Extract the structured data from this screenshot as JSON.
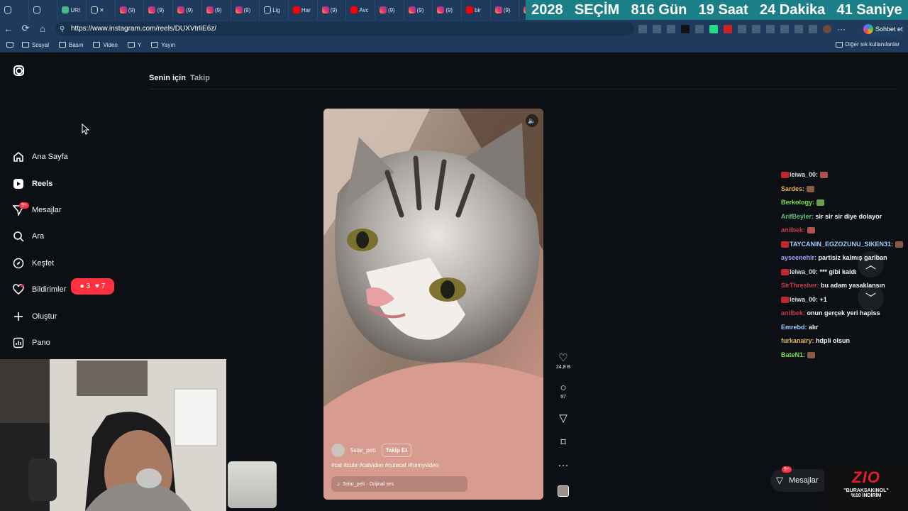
{
  "browser": {
    "tabs": [
      {
        "icon": "chevron-down-icon",
        "label": ""
      },
      {
        "icon": "tab-groups-icon",
        "label": ""
      },
      {
        "icon": "uri-icon",
        "label": "URI"
      },
      {
        "icon": "audio-icon",
        "label": "✕"
      },
      {
        "icon": "instagram-icon",
        "label": "(9)"
      },
      {
        "icon": "instagram-icon",
        "label": "(9)"
      },
      {
        "icon": "instagram-icon",
        "label": "(9)"
      },
      {
        "icon": "instagram-icon",
        "label": "(9)"
      },
      {
        "icon": "instagram-icon",
        "label": "(9)"
      },
      {
        "icon": "pen-icon",
        "label": "Lig"
      },
      {
        "icon": "youtube-icon",
        "label": "Har"
      },
      {
        "icon": "instagram-icon",
        "label": "(9)"
      },
      {
        "icon": "youtube-icon",
        "label": "Avc"
      },
      {
        "icon": "instagram-icon",
        "label": "(9)"
      },
      {
        "icon": "instagram-icon",
        "label": "(9)"
      },
      {
        "icon": "instagram-icon",
        "label": "(9)"
      },
      {
        "icon": "youtube-icon",
        "label": "bir"
      },
      {
        "icon": "instagram-icon",
        "label": "(9)"
      },
      {
        "icon": "instagram-icon",
        "label": "(9)"
      }
    ],
    "countdown": [
      "2028",
      "SEÇİM",
      "816 Gün",
      "19 Saat",
      "24 Dakika",
      "41 Saniye"
    ],
    "url": "https://www.instagram.com/reels/DUXVtrliE6z/",
    "chat_button": "Sohbet et",
    "bookmarks": [
      "Sosyal",
      "Basın",
      "Video",
      "Y",
      "Yayın"
    ],
    "other_bookmarks": "Diğer sık kullanılanlar"
  },
  "instagram": {
    "sidebar": [
      {
        "name": "home",
        "label": "Ana Sayfa",
        "icon": "home-icon"
      },
      {
        "name": "reels",
        "label": "Reels",
        "icon": "reels-icon"
      },
      {
        "name": "messages",
        "label": "Mesajlar",
        "icon": "messages-icon"
      },
      {
        "name": "search",
        "label": "Ara",
        "icon": "search-icon"
      },
      {
        "name": "explore",
        "label": "Keşfet",
        "icon": "compass-icon"
      },
      {
        "name": "notifications",
        "label": "Bildirimler",
        "icon": "heart-icon"
      },
      {
        "name": "create",
        "label": "Oluştur",
        "icon": "plus-icon"
      },
      {
        "name": "dashboard",
        "label": "Pano",
        "icon": "chart-icon"
      }
    ],
    "messages_badge": "9+",
    "notif_comments": "3",
    "notif_likes": "7",
    "tabs": {
      "for_you": "Senin için",
      "following": "Takip"
    },
    "reel": {
      "author": "5star_pett",
      "follow": "Takip Et",
      "hashtags": "#cat #cute #catvideo #cutecat #funnyvideo",
      "audio": "5star_pett · Orijinal ses",
      "likes": "24,8 B",
      "comments": "97"
    },
    "floating_messages": "Mesajlar",
    "floating_badge": "9+"
  },
  "stream_chat": [
    {
      "user": "leiwa_00:",
      "text": "",
      "color": "#dedede"
    },
    {
      "user": "Sardes:",
      "text": "",
      "color": "#e6b35a"
    },
    {
      "user": "Berkology:",
      "text": "",
      "color": "#7ddf4a"
    },
    {
      "user": "ArifBeyler:",
      "text": "sir sir sir diye dolayor",
      "color": "#5fc27a"
    },
    {
      "user": "anilbek:",
      "text": "",
      "color": "#c93a4b"
    },
    {
      "user": "TAYCANIN_EGZOZUNU_SIKEN31:",
      "text": "",
      "color": "#9fd0ff"
    },
    {
      "user": "ayseenehir:",
      "text": "partisiz kalmış gariban",
      "color": "#a9a0ff"
    },
    {
      "user": "leiwa_00:",
      "text": "*** gibi kaldı",
      "color": "#dedede"
    },
    {
      "user": "SirThresher:",
      "text": "bu adam yasaklansın",
      "color": "#c93a4b"
    },
    {
      "user": "leiwa_00:",
      "text": "+1",
      "color": "#dedede"
    },
    {
      "user": "anilbek:",
      "text": "onun gerçek yeri hapiss",
      "color": "#c93a4b"
    },
    {
      "user": "Emrebd:",
      "text": "alır",
      "color": "#9fd0ff"
    },
    {
      "user": "furkanairy:",
      "text": "hdpli olsun",
      "color": "#e6b35a"
    },
    {
      "user": "BateN1:",
      "text": "",
      "color": "#7ddf4a"
    }
  ],
  "promo": {
    "logo": "ZIO",
    "line1": "\"BURAKSAKINOL\"",
    "line2": "%10 İNDİRİM"
  }
}
